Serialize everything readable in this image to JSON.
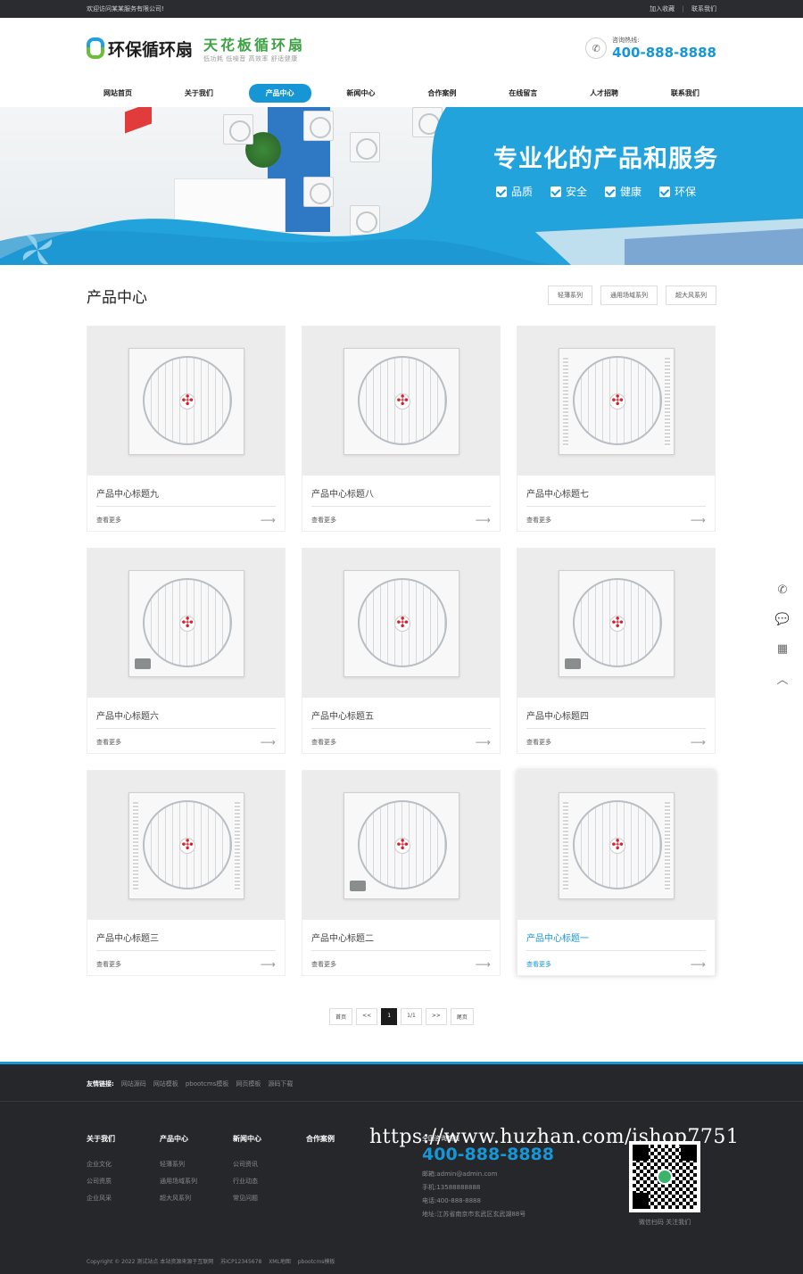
{
  "topbar": {
    "welcome": "欢迎访问某某服务有限公司!",
    "favorite": "加入收藏",
    "separator": "|",
    "contact": "联系我们"
  },
  "header": {
    "logo_name": "环保循环扇",
    "slogan_big": "天花板循环扇",
    "slogan_small": "低功耗 低噪音 高效率 舒适健康",
    "hotline_label": "咨询热线:",
    "hotline_number": "400-888-8888"
  },
  "nav": {
    "items": [
      {
        "label": "网站首页"
      },
      {
        "label": "关于我们"
      },
      {
        "label": "产品中心"
      },
      {
        "label": "新闻中心"
      },
      {
        "label": "合作案例"
      },
      {
        "label": "在线留言"
      },
      {
        "label": "人才招聘"
      },
      {
        "label": "联系我们"
      }
    ],
    "active_index": 2
  },
  "banner": {
    "title": "专业化的产品和服务",
    "checks": [
      "品质",
      "安全",
      "健康",
      "环保"
    ]
  },
  "section": {
    "title": "产品中心",
    "categories": [
      "轻薄系列",
      "通用场域系列",
      "超大风系列"
    ]
  },
  "products": [
    {
      "title": "产品中心标题九",
      "more": "查看更多"
    },
    {
      "title": "产品中心标题八",
      "more": "查看更多"
    },
    {
      "title": "产品中心标题七",
      "more": "查看更多"
    },
    {
      "title": "产品中心标题六",
      "more": "查看更多"
    },
    {
      "title": "产品中心标题五",
      "more": "查看更多"
    },
    {
      "title": "产品中心标题四",
      "more": "查看更多"
    },
    {
      "title": "产品中心标题三",
      "more": "查看更多"
    },
    {
      "title": "产品中心标题二",
      "more": "查看更多"
    },
    {
      "title": "产品中心标题一",
      "more": "查看更多"
    }
  ],
  "pager": {
    "first": "首页",
    "prev": "<<",
    "current": "1",
    "info": "1/1",
    "next": ">>",
    "last": "尾页"
  },
  "footer": {
    "friend_label": "友情链接:",
    "friend_links": [
      "网站源码",
      "网站模板",
      "pbootcms模板",
      "网页模板",
      "源码下载"
    ],
    "columns": [
      {
        "heading": "关于我们",
        "items": [
          "企业文化",
          "公司资质",
          "企业风采"
        ]
      },
      {
        "heading": "产品中心",
        "items": [
          "轻薄系列",
          "通用场域系列",
          "超大风系列"
        ]
      },
      {
        "heading": "新闻中心",
        "items": [
          "公司资讯",
          "行业动态",
          "常见问题"
        ]
      },
      {
        "heading": "合作案例",
        "items": []
      }
    ],
    "contact_label": "全国咨询热线",
    "contact_number": "400-888-8888",
    "email": "邮箱:admin@admin.com",
    "mobile": "手机:13588888888",
    "phone": "电话:400-888-8888",
    "address": "地址:江苏省南京市玄武区玄武湖88号",
    "qr_caption": "微信扫码 关注我们",
    "copyright": [
      "Copyright © 2022 测试站点 本站资源来源于互联网",
      "苏ICP12345678",
      "XML地图",
      "pbootcms模板"
    ]
  },
  "watermark": "https://www.huzhan.com/ishop7751",
  "sidebar": {
    "icons": [
      "phone-icon",
      "chat-icon",
      "qrcode-icon",
      "back-to-top-icon"
    ]
  }
}
